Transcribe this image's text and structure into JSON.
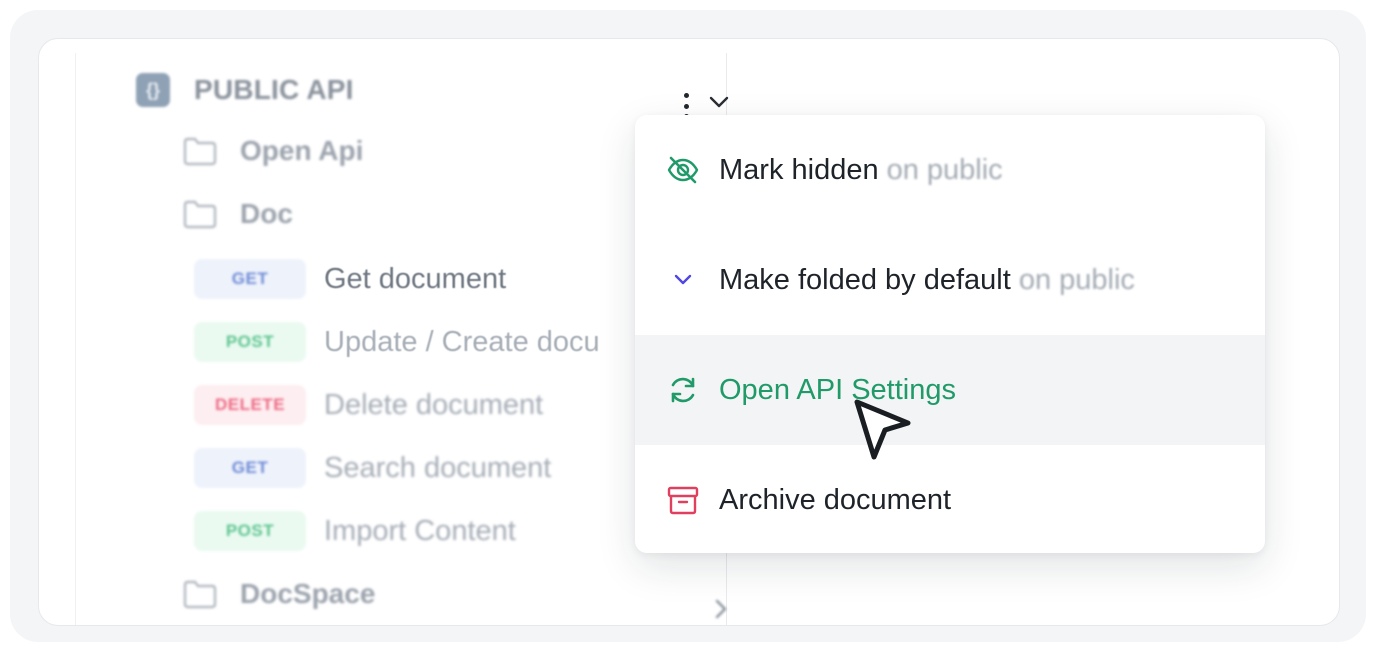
{
  "tree": {
    "section": {
      "icon_letter": "{}",
      "title": "PUBLIC API",
      "icon": "code-block-icon"
    },
    "folders": [
      {
        "label": "Open Api",
        "icon": "folder-icon"
      },
      {
        "label": "Doc",
        "icon": "folder-icon"
      }
    ],
    "endpoints": [
      {
        "method": "GET",
        "label": "Get document"
      },
      {
        "method": "POST",
        "label": "Update / Create docu"
      },
      {
        "method": "DELETE",
        "label": "Delete document"
      },
      {
        "method": "GET",
        "label": "Search document"
      },
      {
        "method": "POST",
        "label": "Import Content"
      }
    ],
    "collapsed_folder": {
      "label": "DocSpace",
      "icon": "folder-icon"
    }
  },
  "menu": {
    "items": [
      {
        "label": "Mark hidden",
        "suffix": "on public",
        "icon": "eye-off-icon",
        "icon_color": "#1f9a68"
      },
      {
        "label": "Make folded by default",
        "suffix": "on public",
        "icon": "chevron-down-icon",
        "icon_color": "#4f46e5"
      },
      {
        "label": "Open API Settings",
        "suffix": "",
        "icon": "refresh-icon",
        "icon_color": "#1f9a68",
        "state": "hovered"
      },
      {
        "label": "Archive document",
        "suffix": "",
        "icon": "archive-icon",
        "icon_color": "#e0405e"
      }
    ]
  },
  "colors": {
    "accent_green": "#1f9a68",
    "accent_indigo": "#4f46e5",
    "danger_red": "#e0405e",
    "get_badge": "#6e8bd6",
    "post_badge": "#5ec48f",
    "delete_badge": "#ee6a84"
  }
}
